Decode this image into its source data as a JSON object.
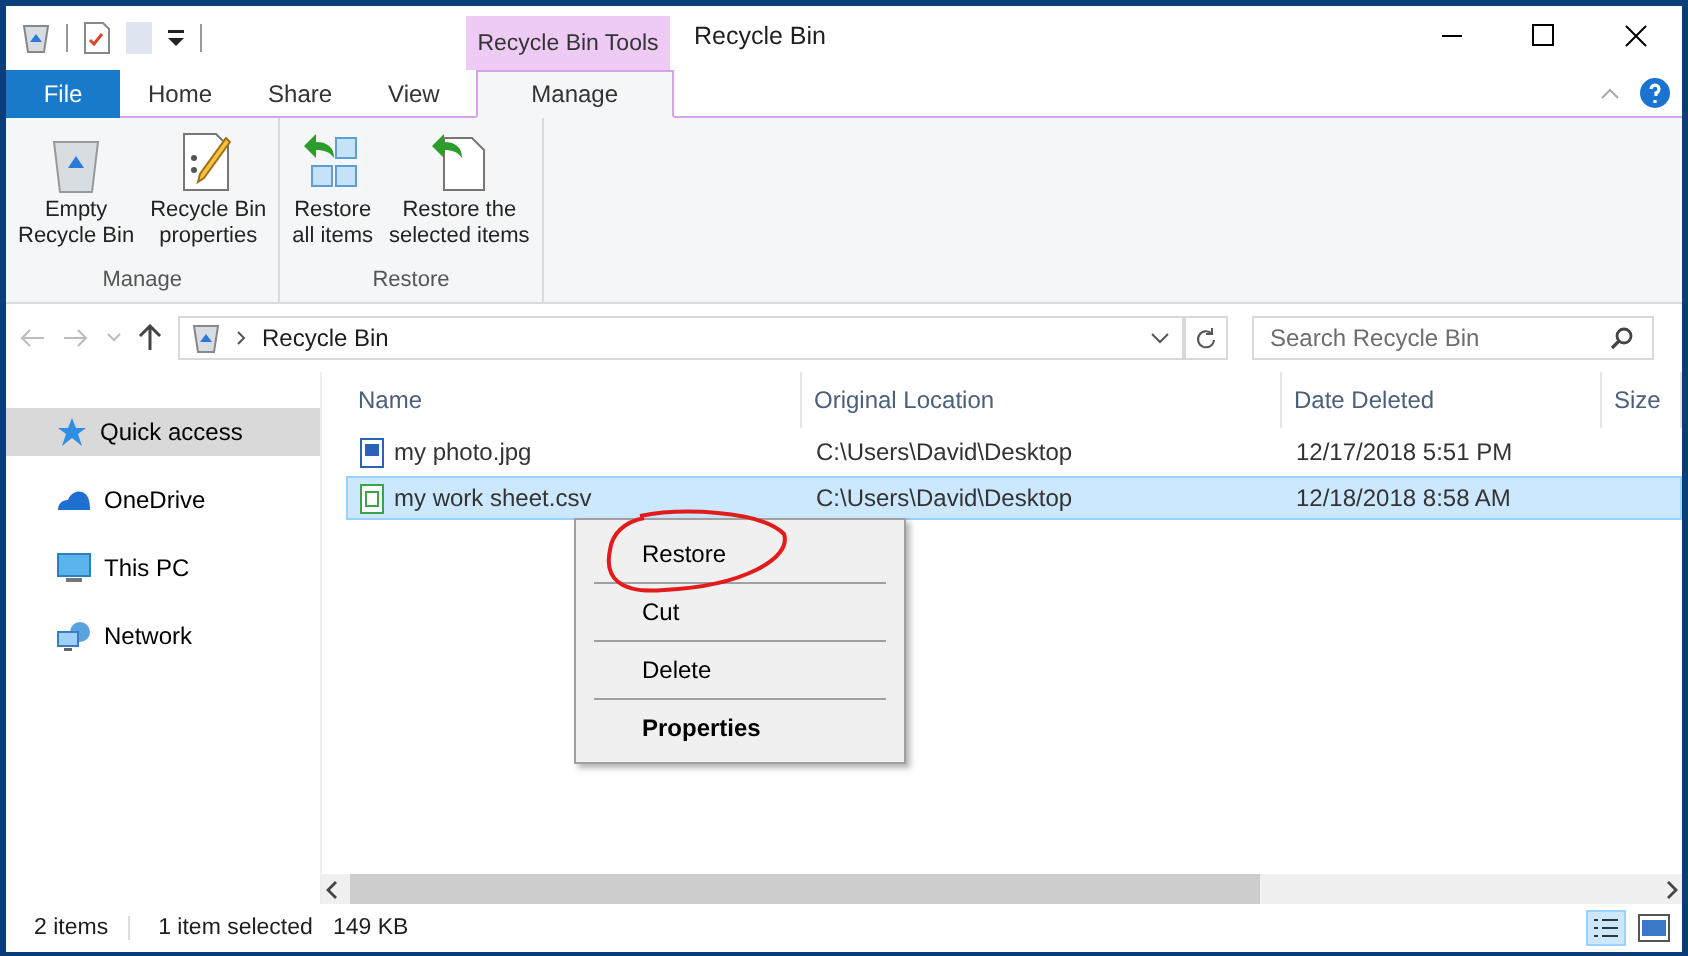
{
  "window": {
    "title": "Recycle Bin",
    "context_tab": "Recycle Bin Tools"
  },
  "ribbon_tabs": [
    {
      "label": "File",
      "kind": "file",
      "selected": false
    },
    {
      "label": "Home",
      "kind": "tab",
      "selected": false
    },
    {
      "label": "Share",
      "kind": "tab",
      "selected": false
    },
    {
      "label": "View",
      "kind": "tab",
      "selected": false
    },
    {
      "label": "Manage",
      "kind": "tab",
      "selected": true
    }
  ],
  "ribbon_groups": [
    {
      "label": "Manage",
      "commands": [
        {
          "label": "Empty\nRecycle Bin",
          "kind": "empty"
        },
        {
          "label": "Recycle Bin\nproperties",
          "kind": "properties"
        }
      ]
    },
    {
      "label": "Restore",
      "commands": [
        {
          "label": "Restore\nall items",
          "kind": "restore-all"
        },
        {
          "label": "Restore the\nselected items",
          "kind": "restore-selected"
        }
      ]
    }
  ],
  "address": {
    "path": "Recycle Bin"
  },
  "search": {
    "placeholder": "Search Recycle Bin"
  },
  "sidebar": {
    "items": [
      {
        "label": "Quick access",
        "kind": "star",
        "selected": true
      },
      {
        "label": "OneDrive",
        "kind": "cloud",
        "selected": false
      },
      {
        "label": "This PC",
        "kind": "pc",
        "selected": false
      },
      {
        "label": "Network",
        "kind": "network",
        "selected": false
      }
    ]
  },
  "table": {
    "columns": [
      "Name",
      "Original Location",
      "Date Deleted",
      "Size"
    ],
    "rows": [
      {
        "kind": "image",
        "cells": [
          "my photo.jpg",
          "C:\\Users\\David\\Desktop",
          "12/17/2018 5:51 PM"
        ],
        "selected": false
      },
      {
        "kind": "sheet",
        "cells": [
          "my work sheet.csv",
          "C:\\Users\\David\\Desktop",
          "12/18/2018 8:58 AM"
        ],
        "selected": true
      }
    ]
  },
  "context_menu": {
    "items": [
      {
        "label": "Restore",
        "bold": false
      },
      {
        "label": "Cut",
        "bold": false
      },
      {
        "label": "Delete",
        "bold": false
      },
      {
        "label": "Properties",
        "bold": true
      }
    ]
  },
  "status_bar": {
    "count": "2 items",
    "selection": "1 item selected",
    "size": "149 KB"
  }
}
